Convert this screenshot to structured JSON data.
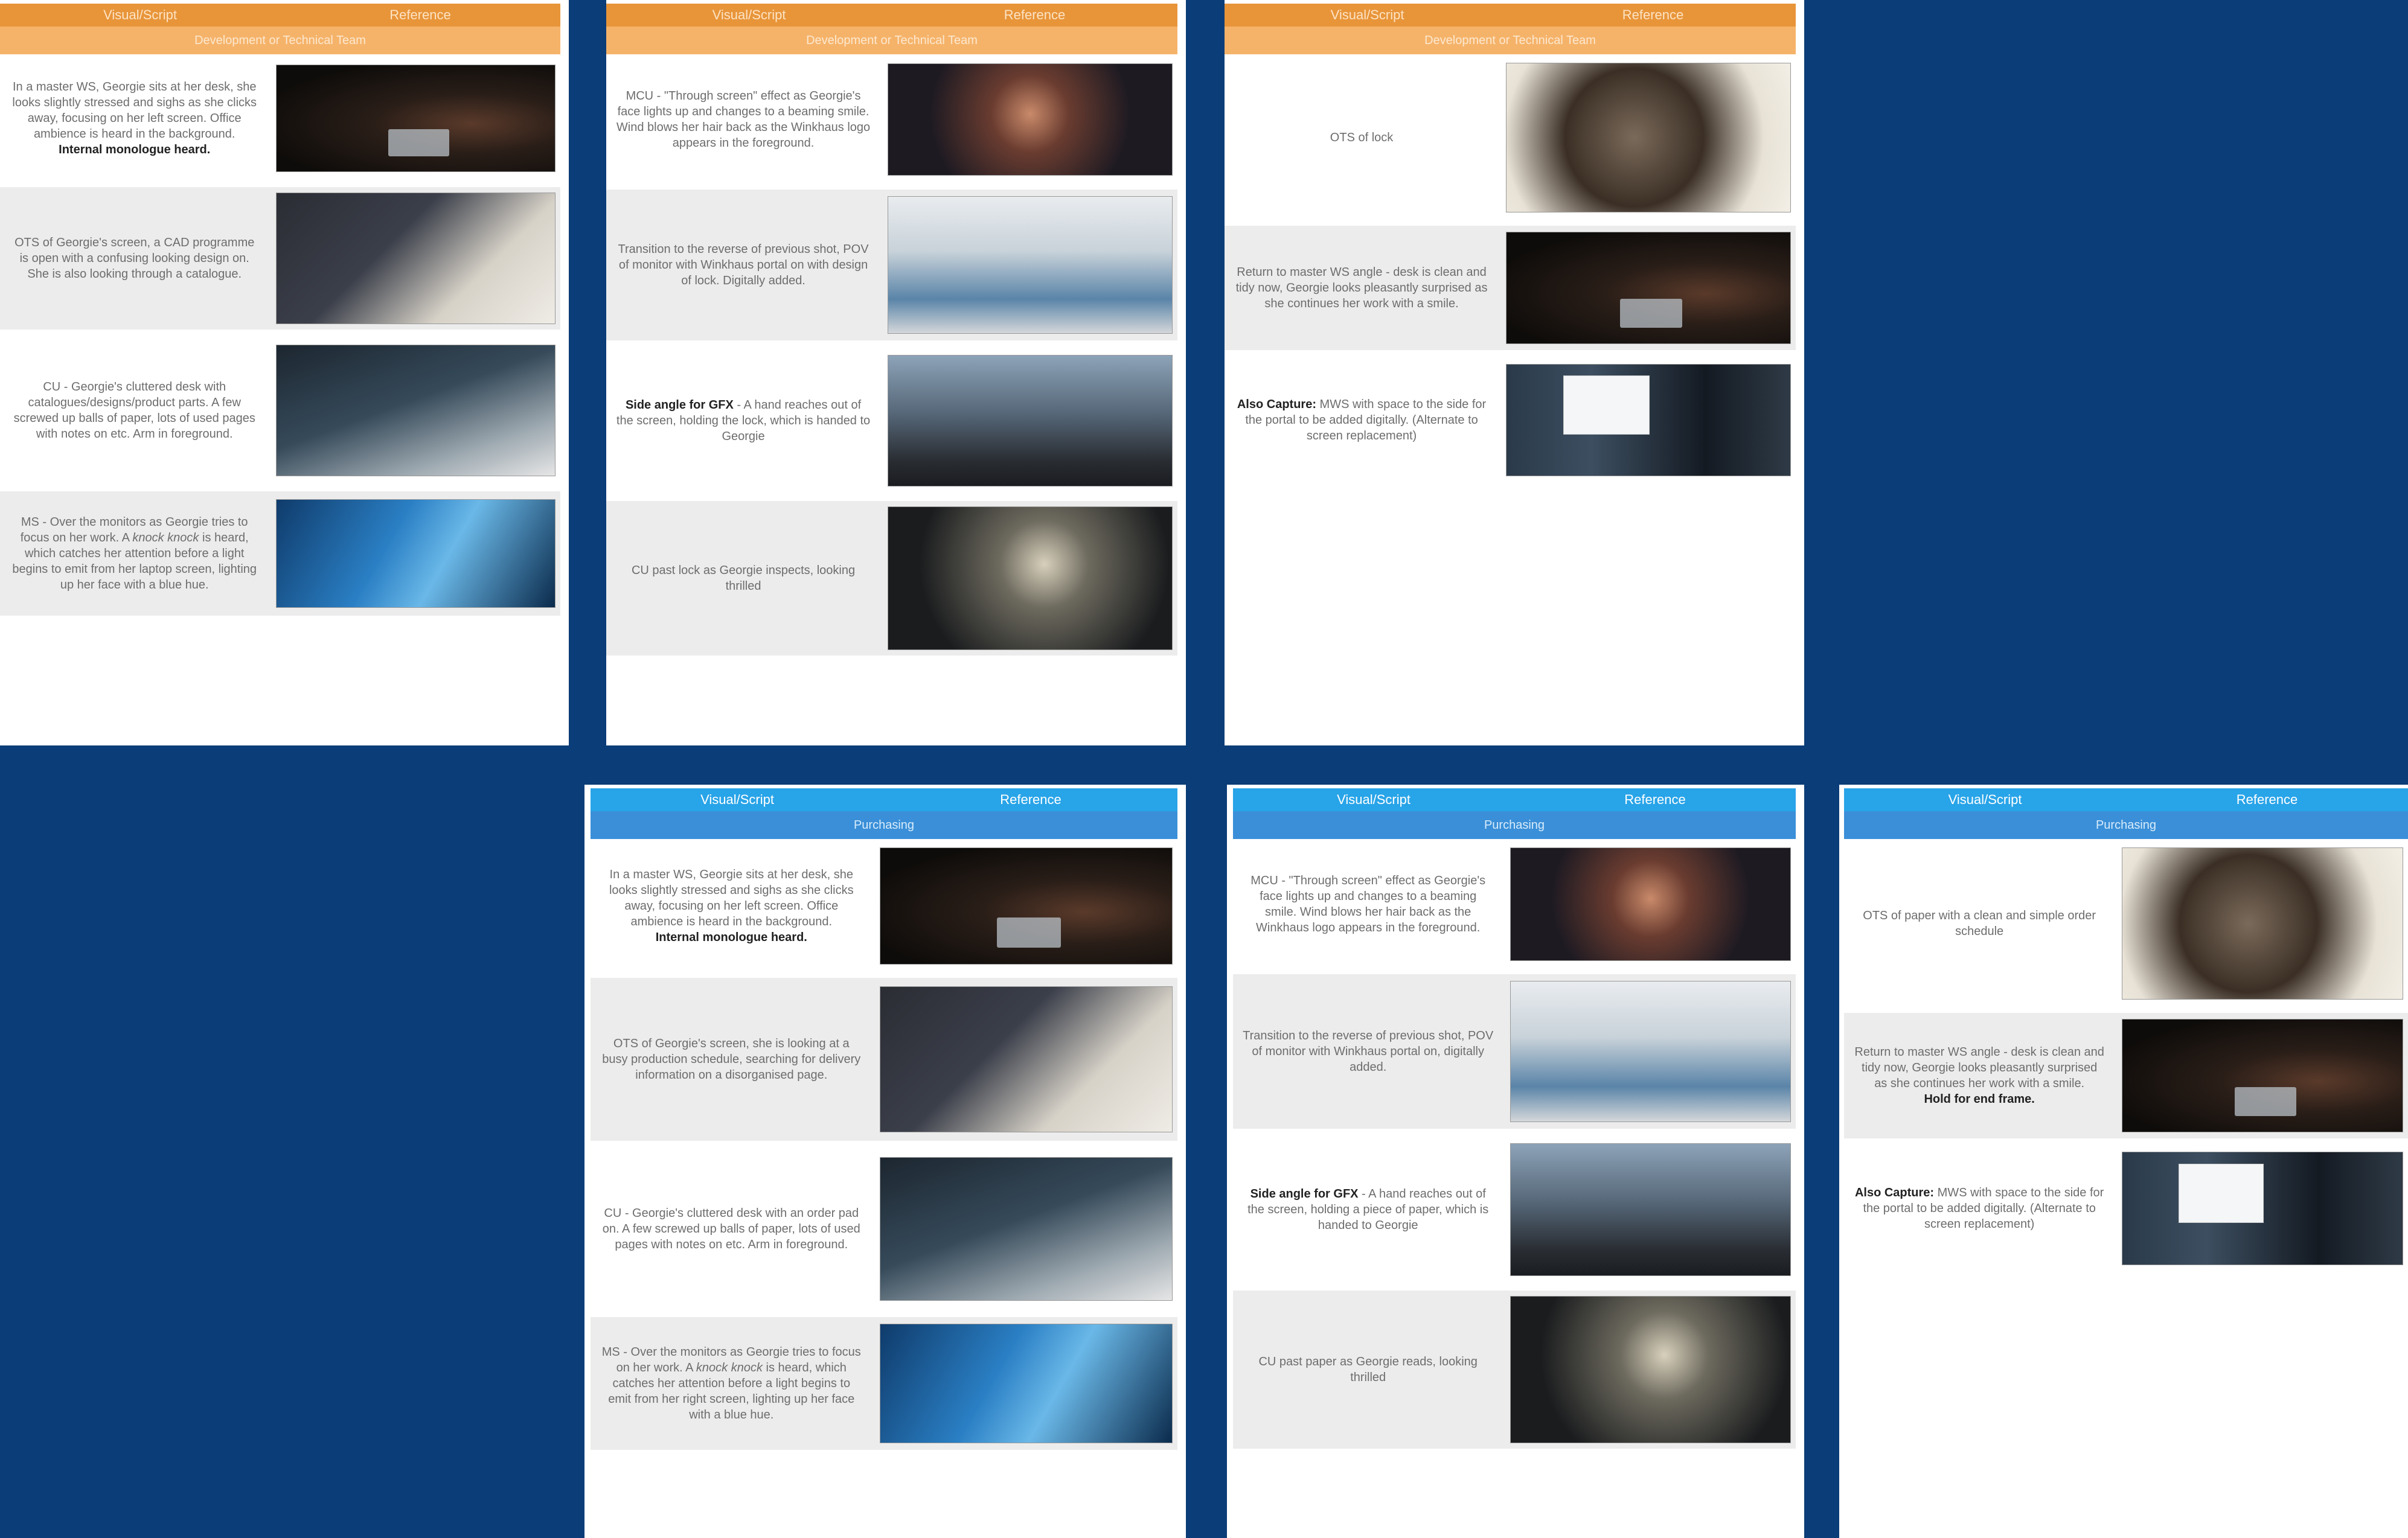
{
  "headers": {
    "visual": "Visual/Script",
    "reference": "Reference"
  },
  "teams": {
    "dev": "Development or Technical Team",
    "purchasing": "Purchasing"
  },
  "colors": {
    "background": "#0b3d78",
    "dev_header": "#e8953a",
    "dev_subheader": "#f5b36a",
    "purchasing_header": "#28a4e8",
    "purchasing_subheader": "#3a8fd8"
  },
  "pages": {
    "p1": {
      "rows": [
        {
          "pre": "In a master WS, Georgie sits at her desk, she looks slightly stressed and sighs as she clicks away, focusing on her left screen. Office ambience is heard in the background.",
          "bold": "Internal monologue heard.",
          "post": ""
        },
        {
          "pre": "OTS of Georgie's screen, a CAD programme is open with a confusing looking design on. She is also looking through a catalogue.",
          "bold": "",
          "post": ""
        },
        {
          "pre": "CU - Georgie's cluttered desk with catalogues/designs/product parts. A few screwed up balls of paper, lots of used pages with notes on etc. Arm in foreground.",
          "bold": "",
          "post": ""
        },
        {
          "pre": "MS - Over the monitors as Georgie tries to focus on her work. A ",
          "italic": "knock knock",
          "post": " is heard, which catches her attention before a light begins to emit from her laptop screen, lighting up her face with a blue hue.",
          "bold": ""
        }
      ]
    },
    "p2": {
      "rows": [
        {
          "pre": "MCU - \"Through screen\" effect as Georgie's face lights up and changes to a beaming smile. Wind blows her hair back as the Winkhaus logo appears in the foreground.",
          "bold": "",
          "post": ""
        },
        {
          "pre": "Transition to the reverse of previous shot, POV of monitor with Winkhaus portal on with design of lock. Digitally added.",
          "bold": "",
          "post": ""
        },
        {
          "bold": "Side angle for GFX",
          "post": " - A hand reaches out of the screen, holding the lock, which is handed to Georgie",
          "pre": ""
        },
        {
          "pre": "CU past lock as Georgie inspects, looking thrilled",
          "bold": "",
          "post": ""
        }
      ]
    },
    "p3": {
      "rows": [
        {
          "pre": "OTS of lock",
          "bold": "",
          "post": ""
        },
        {
          "pre": "Return to master WS angle - desk is clean and tidy now, Georgie looks pleasantly surprised as she continues her work with a smile.",
          "bold": "",
          "post": ""
        },
        {
          "bold": "Also Capture:",
          "post": " MWS with space to the side for the portal to be added digitally. (Alternate to screen replacement)",
          "pre": ""
        }
      ]
    },
    "p4": {
      "rows": [
        {
          "pre": "In a master WS, Georgie sits at her desk, she looks slightly stressed and sighs as she clicks away, focusing on her left screen. Office ambience is heard in the background.",
          "bold": "Internal monologue heard.",
          "post": ""
        },
        {
          "pre": "OTS of Georgie's screen, she is looking at a busy production schedule, searching for delivery information on a disorganised page.",
          "bold": "",
          "post": ""
        },
        {
          "pre": "CU - Georgie's cluttered desk with an order pad on. A few screwed up balls of paper, lots of used pages with notes on etc. Arm in foreground.",
          "bold": "",
          "post": ""
        },
        {
          "pre": "MS - Over the monitors as Georgie tries to focus on her work. A ",
          "italic": "knock knock",
          "post": " is heard, which catches her attention before a light begins to emit from her right screen, lighting up her face with a blue hue.",
          "bold": ""
        }
      ]
    },
    "p5": {
      "rows": [
        {
          "pre": "MCU - \"Through screen\" effect as Georgie's face lights up and changes to a beaming smile. Wind blows her hair back as the Winkhaus logo appears in the foreground.",
          "bold": "",
          "post": ""
        },
        {
          "pre": "Transition to the reverse of previous shot, POV of monitor with Winkhaus portal on, digitally added.",
          "bold": "",
          "post": ""
        },
        {
          "bold": "Side angle for GFX",
          "post": " - A hand reaches out of the screen, holding a piece of paper, which is handed to Georgie",
          "pre": ""
        },
        {
          "pre": "CU past paper as Georgie reads, looking thrilled",
          "bold": "",
          "post": ""
        }
      ]
    },
    "p6": {
      "rows": [
        {
          "pre": "OTS of paper with a clean and simple order schedule",
          "bold": "",
          "post": ""
        },
        {
          "pre": "Return to master WS angle - desk is clean and tidy now, Georgie looks pleasantly surprised as she continues her work with a smile.",
          "bold": "Hold for end frame.",
          "post": ""
        },
        {
          "bold": "Also Capture:",
          "post": " MWS with space to the side for the portal to be added digitally. (Alternate to screen replacement)",
          "pre": ""
        }
      ]
    }
  }
}
